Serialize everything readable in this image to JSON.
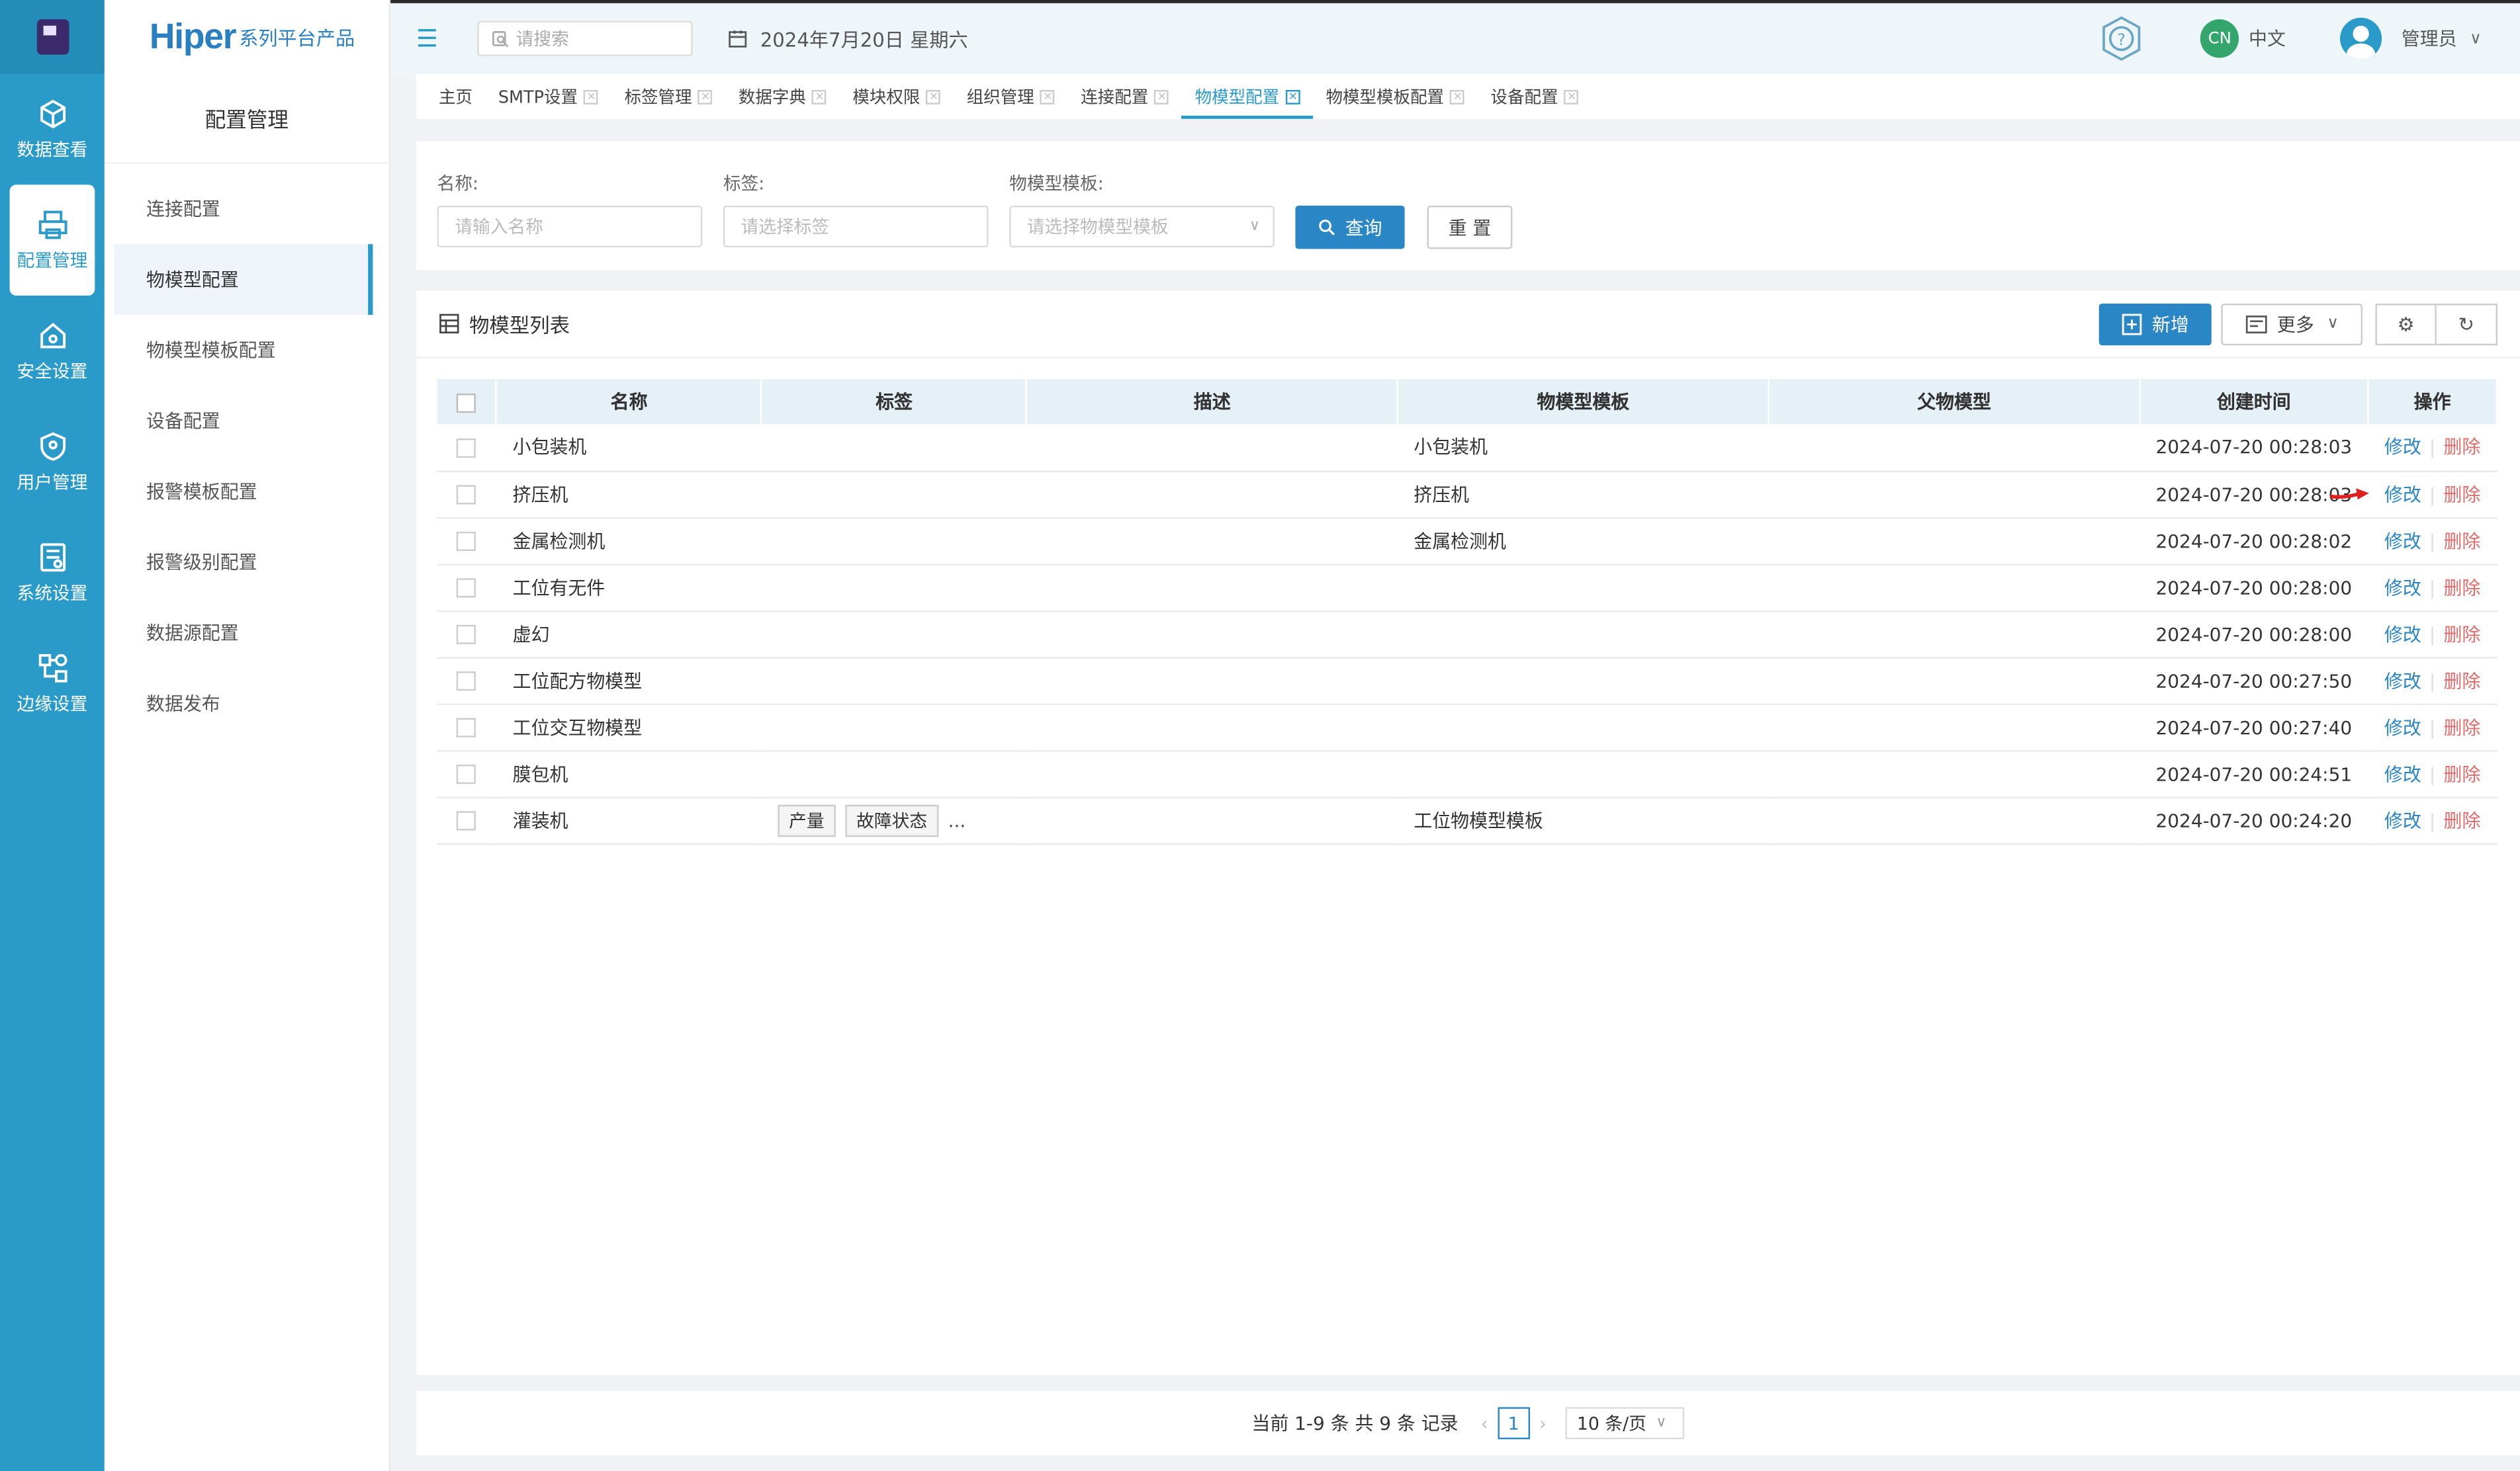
{
  "rail": {
    "items": [
      {
        "label": "数据查看",
        "icon": "cube-icon"
      },
      {
        "label": "配置管理",
        "icon": "printer-config-icon"
      },
      {
        "label": "安全设置",
        "icon": "home-shield-icon"
      },
      {
        "label": "用户管理",
        "icon": "user-shield-icon"
      },
      {
        "label": "系统设置",
        "icon": "server-gear-icon"
      },
      {
        "label": "边缘设置",
        "icon": "network-nodes-icon"
      }
    ]
  },
  "brand": {
    "main": "Hiper",
    "sub": "系列平台产品"
  },
  "sidebar": {
    "title": "配置管理",
    "items": [
      "连接配置",
      "物模型配置",
      "物模型模板配置",
      "设备配置",
      "报警模板配置",
      "报警级别配置",
      "数据源配置",
      "数据发布"
    ]
  },
  "topbar": {
    "search_placeholder": "请搜索",
    "date": "2024年7月20日 星期六",
    "lang_badge": "CN",
    "lang_label": "中文",
    "user_name": "管理员"
  },
  "tabs": [
    "主页",
    "SMTP设置",
    "标签管理",
    "数据字典",
    "模块权限",
    "组织管理",
    "连接配置",
    "物模型配置",
    "物模型模板配置",
    "设备配置"
  ],
  "filter": {
    "name_label": "名称:",
    "name_placeholder": "请输入名称",
    "tag_label": "标签:",
    "tag_placeholder": "请选择标签",
    "template_label": "物模型模板:",
    "template_placeholder": "请选择物模型模板",
    "query_label": "查询",
    "reset_label": "重 置"
  },
  "list": {
    "title": "物模型列表",
    "add_label": "新增",
    "more_label": "更多",
    "columns": [
      "名称",
      "标签",
      "描述",
      "物模型模板",
      "父物模型",
      "创建时间",
      "操作"
    ],
    "edit_label": "修改",
    "delete_label": "删除",
    "rows": [
      {
        "name": "小包装机",
        "tags": [],
        "desc": "",
        "template": "小包装机",
        "parent": "",
        "time": "2024-07-20 00:28:03"
      },
      {
        "name": "挤压机",
        "tags": [],
        "desc": "",
        "template": "挤压机",
        "parent": "",
        "time": "2024-07-20 00:28:03"
      },
      {
        "name": "金属检测机",
        "tags": [],
        "desc": "",
        "template": "金属检测机",
        "parent": "",
        "time": "2024-07-20 00:28:02"
      },
      {
        "name": "工位有无件",
        "tags": [],
        "desc": "",
        "template": "",
        "parent": "",
        "time": "2024-07-20 00:28:00"
      },
      {
        "name": "虚幻",
        "tags": [],
        "desc": "",
        "template": "",
        "parent": "",
        "time": "2024-07-20 00:28:00"
      },
      {
        "name": "工位配方物模型",
        "tags": [],
        "desc": "",
        "template": "",
        "parent": "",
        "time": "2024-07-20 00:27:50"
      },
      {
        "name": "工位交互物模型",
        "tags": [],
        "desc": "",
        "template": "",
        "parent": "",
        "time": "2024-07-20 00:27:40"
      },
      {
        "name": "膜包机",
        "tags": [],
        "desc": "",
        "template": "",
        "parent": "",
        "time": "2024-07-20 00:24:51"
      },
      {
        "name": "灌装机",
        "tags": [
          "产量",
          "故障状态"
        ],
        "tag_more": "...",
        "desc": "",
        "template": "工位物模型模板",
        "parent": "",
        "time": "2024-07-20 00:24:20"
      }
    ]
  },
  "pager": {
    "summary": "当前 1-9 条 共 9 条 记录",
    "page": "1",
    "page_size": "10 条/页"
  },
  "colors": {
    "primary": "#2a86c4",
    "rail": "#2a9bc9",
    "danger": "#e06b6b"
  }
}
